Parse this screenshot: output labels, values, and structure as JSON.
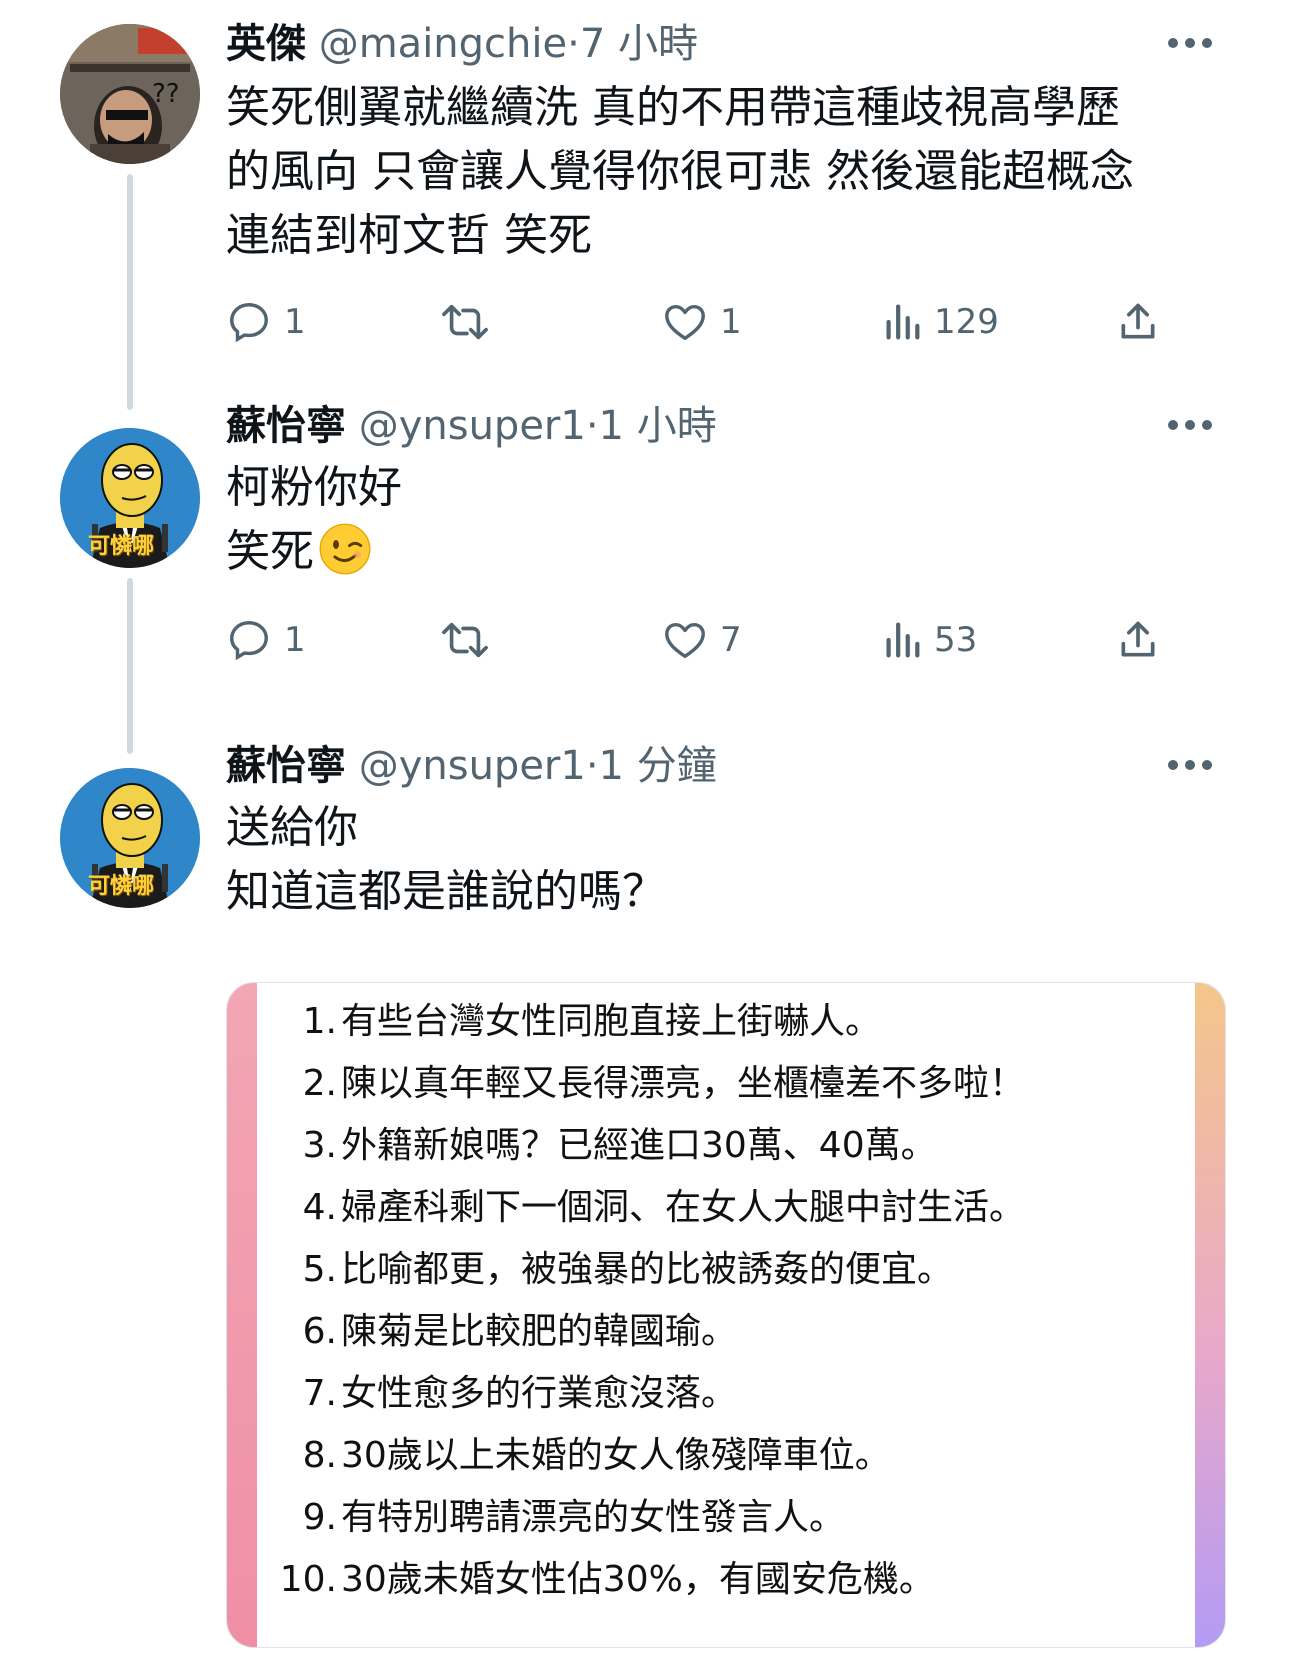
{
  "colors": {
    "text": "#0f1419",
    "secondary": "#536471",
    "thread_line": "#cfd9de"
  },
  "tweets": [
    {
      "name": "英傑",
      "handle": "@maingchie",
      "separator": "·",
      "time": "7 小時",
      "avatar_icon": "user-avatar-photo",
      "text_lines": [
        "笑死側翼就繼續洗 真的不用帶這種歧視高學歷",
        "的風向 只會讓人覺得你很可悲 然後還能超概念",
        "連結到柯文哲 笑死"
      ],
      "replies": "1",
      "retweets": "",
      "likes": "1",
      "views": "129"
    },
    {
      "name": "蘇怡寧",
      "handle": "@ynsuper1",
      "separator": "·",
      "time": "1 小時",
      "avatar_icon": "cartoon-avatar",
      "avatar_caption": "可憐哪",
      "text_lines": [
        "柯粉你好",
        "笑死"
      ],
      "emoji": "winking-face-emoji",
      "replies": "1",
      "retweets": "",
      "likes": "7",
      "views": "53"
    },
    {
      "name": "蘇怡寧",
      "handle": "@ynsuper1",
      "separator": "·",
      "time": "1 分鐘",
      "avatar_icon": "cartoon-avatar",
      "avatar_caption": "可憐哪",
      "text_lines": [
        "送給你",
        "知道這都是誰說的嗎？"
      ]
    }
  ],
  "quote_image": {
    "items": [
      {
        "num": "1.",
        "text": "有些台灣女性同胞直接上街嚇人。"
      },
      {
        "num": "2.",
        "text": "陳以真年輕又長得漂亮，坐櫃檯差不多啦！"
      },
      {
        "num": "3.",
        "text": "外籍新娘嗎？已經進口30萬、40萬。"
      },
      {
        "num": "4.",
        "text": "婦產科剩下一個洞、在女人大腿中討生活。"
      },
      {
        "num": "5.",
        "text": "比喻都更，被強暴的比被誘姦的便宜。"
      },
      {
        "num": "6.",
        "text": "陳菊是比較肥的韓國瑜。"
      },
      {
        "num": "7.",
        "text": "女性愈多的行業愈沒落。"
      },
      {
        "num": "8.",
        "text": "30歲以上未婚的女人像殘障車位。"
      },
      {
        "num": "9.",
        "text": "有特別聘請漂亮的女性發言人。"
      },
      {
        "num": "10.",
        "text": "30歲未婚女性佔30%，有國安危機。"
      }
    ]
  }
}
